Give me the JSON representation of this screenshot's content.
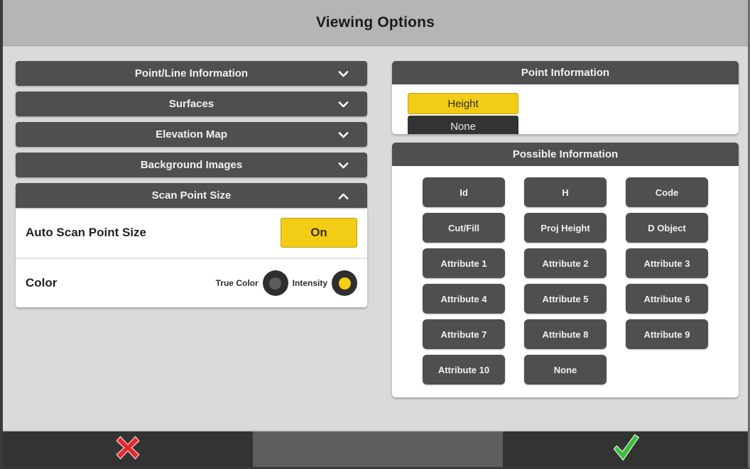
{
  "window": {
    "title": "Viewing Options"
  },
  "left_panel": {
    "accordion": [
      {
        "label": "Point/Line Information",
        "icon": "chevron-down-icon",
        "expanded": false
      },
      {
        "label": "Surfaces",
        "icon": "chevron-down-icon",
        "expanded": false
      },
      {
        "label": "Elevation Map",
        "icon": "chevron-down-icon",
        "expanded": false
      },
      {
        "label": "Background Images",
        "icon": "chevron-down-icon",
        "expanded": false
      },
      {
        "label": "Scan Point Size",
        "icon": "chevron-up-icon",
        "expanded": true
      }
    ],
    "scan_point_size": {
      "auto_scan_point_size": {
        "label": "Auto Scan Point Size",
        "value": "On"
      },
      "color": {
        "label": "Color",
        "options": [
          {
            "label": "True Color",
            "selected": false
          },
          {
            "label": "Intensity",
            "selected": true
          }
        ]
      }
    }
  },
  "right_panel": {
    "point_information": {
      "title": "Point Information",
      "items": [
        {
          "label": "Height",
          "selected": true
        },
        {
          "label": "None",
          "selected": false
        }
      ]
    },
    "possible_information": {
      "title": "Possible Information",
      "items": [
        "Id",
        "H",
        "Code",
        "Cut/Fill",
        "Proj Height",
        "D Object",
        "Attribute 1",
        "Attribute 2",
        "Attribute 3",
        "Attribute 4",
        "Attribute 5",
        "Attribute 6",
        "Attribute 7",
        "Attribute 8",
        "Attribute 9",
        "Attribute 10",
        "None",
        ""
      ]
    }
  },
  "bottom_bar": {
    "cancel": {
      "icon": "cancel-x-icon",
      "color": "#e8262c"
    },
    "accept": {
      "icon": "accept-check-icon",
      "color": "#3dbb3d"
    }
  },
  "colors": {
    "accent_yellow": "#f3cc15",
    "panel_dark": "#4f4f4f",
    "body_bg": "#d9dada",
    "titlebar_bg": "#b5b5b5"
  }
}
